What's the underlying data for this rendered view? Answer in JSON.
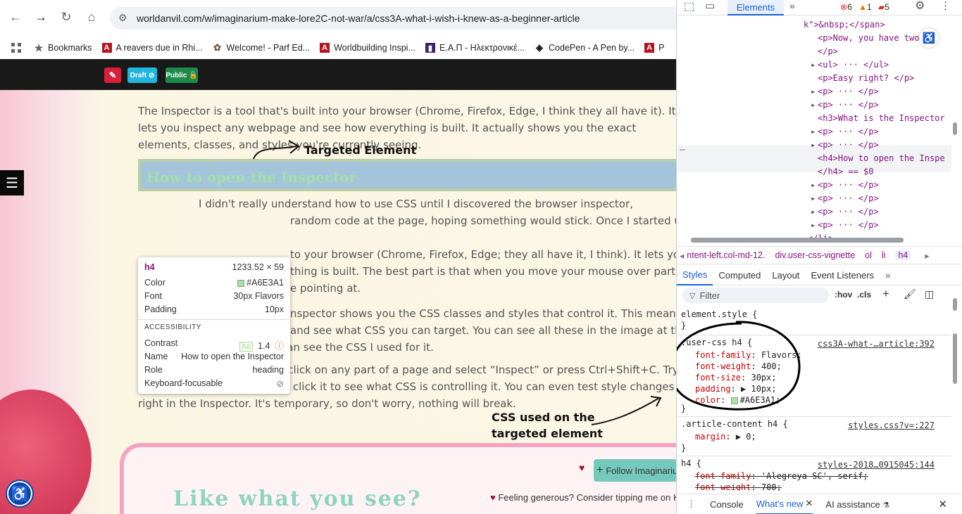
{
  "browser": {
    "url": "worldanvil.com/w/imaginarium-make-lore2C-not-war/a/css3A-what-i-wish-i-knew-as-a-beginner-article",
    "bookmarks": [
      {
        "label": "Bookmarks",
        "icon": "star-icon"
      },
      {
        "label": "A reavers due in Rhi...",
        "icon": "worldanvil-icon"
      },
      {
        "label": "Welcome! - Parf Ed...",
        "icon": "parf-icon"
      },
      {
        "label": "Worldbuilding Inspi...",
        "icon": "worldanvil-icon"
      },
      {
        "label": "Ε.Α.Π - Ηλεκτρονικέ...",
        "icon": "eap-icon"
      },
      {
        "label": "CodePen - A Pen by...",
        "icon": "codepen-icon"
      },
      {
        "label": "P",
        "icon": "worldanvil-icon"
      }
    ]
  },
  "toolbar": {
    "draft_label": "Draft",
    "public_label": "Public"
  },
  "article": {
    "para1": "The Inspector is a tool that's built into your browser (Chrome, Firefox, Edge, I think they all have it). It lets you inspect any webpage and see how everything is built. It actually shows you the exact elements, classes, and styles you're currently seeing.",
    "heading": "How to open the Inspector",
    "para2_line1": "I didn't really understand how to use CSS until I discovered the browser inspector,",
    "para2_line2": "random code at the page, hoping something would stick. Once I started using it,",
    "para3_line1": "to your browser (Chrome, Firefox, Edge; they all have it, I think). It lets you peek",
    "para3_line2": "thing is built. The best part is that when you move your mouse over parts of",
    "para3_line3": "e pointing at.",
    "para4_line1": "nspector shows you the CSS classes and styles that control it. This means you can",
    "para4_line2": "and see what CSS you can target. You can see all these in the image at the top of",
    "para4_line3": "the header above and you can see the CSS I used for it.",
    "para5": "To open the Inspector, right-click on any part of a page and select “Inspect” or press Ctrl+Shift+C. Try it now on the text below and click it to see what CSS is controlling it. You can even test style changes right in the Inspector. It's temporary, so don't worry, nothing will break.",
    "annotation_top": "Targeted Element",
    "annotation_bottom_1": "CSS used on the",
    "annotation_bottom_2": "targeted element",
    "like_heading": "Like what you see?",
    "follow_label": "Follow Imaginarium",
    "tipping_text": "Feeling generous? Consider tipping me on K"
  },
  "tooltip": {
    "tag": "h4",
    "size": "1233.52 × 59",
    "color_label": "Color",
    "color_value": "#A6E3A1",
    "font_label": "Font",
    "font_value": "30px Flavors",
    "padding_label": "Padding",
    "padding_value": "10px",
    "accessibility_header": "ACCESSIBILITY",
    "contrast_label": "Contrast",
    "contrast_badge": "Aa",
    "contrast_value": "1.4",
    "name_label": "Name",
    "name_value": "How to open the Inspector",
    "role_label": "Role",
    "role_value": "heading",
    "keyboard_label": "Keyboard-focusable"
  },
  "devtools": {
    "tab_elements": "Elements",
    "errors": "6",
    "warnings": "1",
    "issues": "5",
    "dom_lines": [
      {
        "indent": 0,
        "text": "k\">&nbsp;</span>"
      },
      {
        "indent": 1,
        "text": "<p>Now, you have two ti"
      },
      {
        "indent": 1,
        "text": "</p>"
      },
      {
        "indent": 1,
        "text": "<ul> ··· </ul>",
        "expand": true
      },
      {
        "indent": 1,
        "text": "<p>Easy right? </p>"
      },
      {
        "indent": 1,
        "text": "<p> ··· </p>",
        "expand": true
      },
      {
        "indent": 1,
        "text": "<p> ··· </p>",
        "expand": true
      },
      {
        "indent": 1,
        "text": "<h3>What is the Inspector"
      },
      {
        "indent": 1,
        "text": "<p> ··· </p>",
        "expand": true
      },
      {
        "indent": 1,
        "text": "<p> ··· </p>",
        "expand": true
      },
      {
        "indent": 1,
        "text": "<h4>How to open the Inspe",
        "selected": true
      },
      {
        "indent": 1,
        "text": "</h4> == $0",
        "selected": true
      },
      {
        "indent": 1,
        "text": "<p> ··· </p>",
        "expand": true
      },
      {
        "indent": 1,
        "text": "<p> ··· </p>",
        "expand": true
      },
      {
        "indent": 1,
        "text": "<p> ··· </p>",
        "expand": true
      },
      {
        "indent": 1,
        "text": "<p> ··· </p>",
        "expand": true
      },
      {
        "indent": 0,
        "text": "</li>"
      }
    ],
    "breadcrumbs": [
      "ntent-left.col-md-12.",
      "div.user-css-vignette",
      "ol",
      "li",
      "h4"
    ],
    "subtabs": [
      "Styles",
      "Computed",
      "Layout",
      "Event Listeners"
    ],
    "filter_placeholder": "Filter",
    "hov": ":hov",
    "cls": ".cls",
    "rules": {
      "element_style": "element.style {",
      "user_css_selector": ".user-css h4 {",
      "user_css_source": "css3A-what-…article:392",
      "user_css_props": [
        {
          "prop": "font-family",
          "val": "Flavors;"
        },
        {
          "prop": "font-weight",
          "val": "400;"
        },
        {
          "prop": "font-size",
          "val": "30px;"
        },
        {
          "prop": "padding",
          "val": "▶ 10px;"
        },
        {
          "prop": "color",
          "val": "#A6E3A1;"
        }
      ],
      "article_selector": ".article-content h4 {",
      "article_source": "styles.css?v=:227",
      "article_props": [
        {
          "prop": "margin",
          "val": "▶ 0;"
        }
      ],
      "h4_selector": "h4 {",
      "h4_source": "styles-2018…0915045:144",
      "h4_props": [
        {
          "prop": "font-family",
          "val": "'Alegreya SC', serif;"
        },
        {
          "prop": "font-weight",
          "val": "700;"
        }
      ],
      "close_brace": "}"
    },
    "drawer_tabs": [
      "Console",
      "What's new",
      "AI assistance"
    ]
  }
}
